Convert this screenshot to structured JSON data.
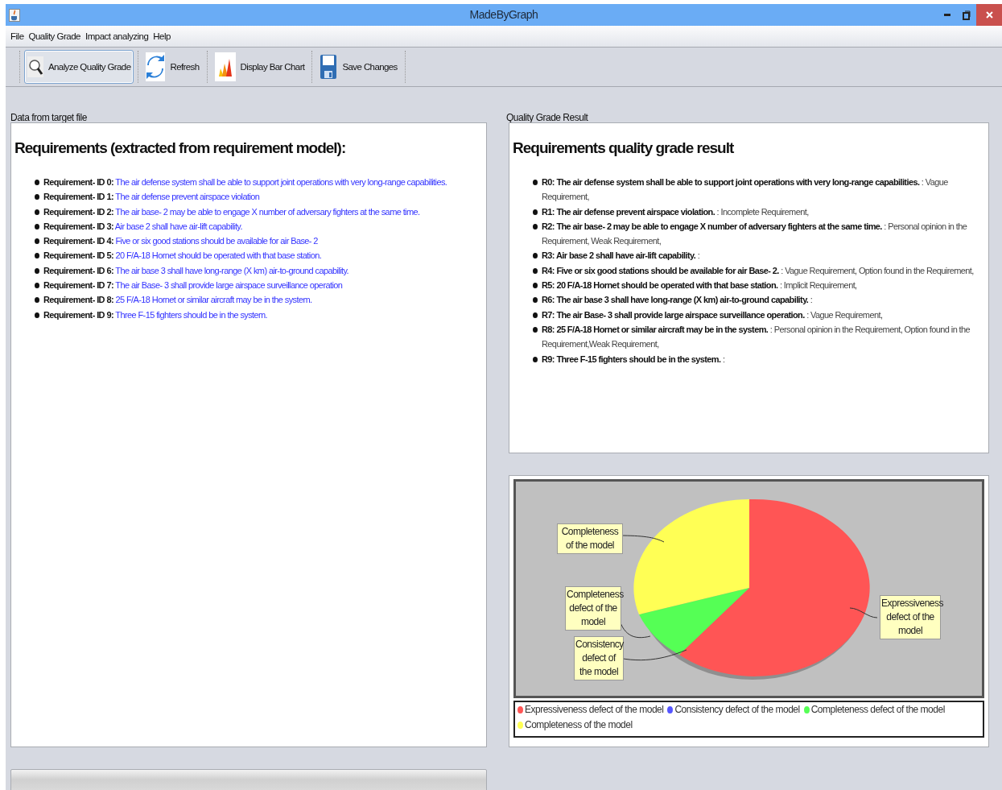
{
  "window": {
    "title": "MadeByGraph"
  },
  "menu": [
    "File",
    "Quality Grade",
    "Impact analyzing",
    "Help"
  ],
  "toolbar": [
    {
      "kind": "analyze",
      "label": "Analyze Quality Grade",
      "pressed": true
    },
    {
      "kind": "refresh",
      "label": "Refresh",
      "pressed": false
    },
    {
      "kind": "chart",
      "label": "Display Bar Chart",
      "pressed": false
    },
    {
      "kind": "save",
      "label": "Save Changes",
      "pressed": false
    }
  ],
  "data_panel": {
    "caption": "Data from target file",
    "heading": "Requirements (extracted from requirement model):",
    "items": [
      {
        "label": "Requirement- ID 0:",
        "text": "The air defense system shall be able to support joint operations with very long-range capabilities."
      },
      {
        "label": "Requirement- ID 1:",
        "text": "The air defense prevent airspace violation"
      },
      {
        "label": "Requirement- ID 2:",
        "text": "The air base- 2 may be able to engage X number of adversary fighters at the same time."
      },
      {
        "label": "Requirement- ID 3:",
        "text": "Air base 2 shall have air-lift capability."
      },
      {
        "label": "Requirement- ID 4:",
        "text": "Five or six good stations should be available for air Base- 2"
      },
      {
        "label": "Requirement- ID 5:",
        "text": "20 F/A-18 Hornet should be operated with that base station."
      },
      {
        "label": "Requirement- ID 6:",
        "text": "The air base 3 shall have long-range (X km) air-to-ground capability."
      },
      {
        "label": "Requirement- ID 7:",
        "text": "The air Base- 3 shall provide large airspace surveillance operation"
      },
      {
        "label": "Requirement- ID 8:",
        "text": "25 F/A-18 Hornet or similar aircraft may be in the system."
      },
      {
        "label": "Requirement- ID 9:",
        "text": "Three F-15 fighters should be in the system."
      }
    ]
  },
  "result_panel": {
    "caption": "Quality Grade Result",
    "heading": "Requirements quality grade result",
    "items": [
      {
        "requirement": "R0: The air defense system shall be able to support joint operations with very long-range capabilities.",
        "grade": ": Vague Requirement,"
      },
      {
        "requirement": "R1: The air defense prevent airspace violation.",
        "grade": ": Incomplete Requirement,"
      },
      {
        "requirement": "R2: The air base- 2 may be able to engage X number of adversary fighters at the same time.",
        "grade": ": Personal opinion in the Requirement, Weak Requirement,"
      },
      {
        "requirement": "R3: Air base 2 shall have air-lift capability.",
        "grade": ":"
      },
      {
        "requirement": "R4: Five or six good stations should be available for air Base- 2.",
        "grade": ": Vague Requirement, Option found in the Requirement,"
      },
      {
        "requirement": "R5: 20 F/A-18 Hornet should be operated with that base station.",
        "grade": ": Implicit Requirement,"
      },
      {
        "requirement": "R6: The air base 3 shall have long-range (X km) air-to-ground capability.",
        "grade": ":"
      },
      {
        "requirement": "R7: The air Base- 3 shall provide large airspace surveillance operation.",
        "grade": ": Vague Requirement,"
      },
      {
        "requirement": "R8: 25 F/A-18 Hornet or similar aircraft may be in the system.",
        "grade": ": Personal opinion in the Requirement, Option found in the Requirement,Weak Requirement,"
      },
      {
        "requirement": "R9: Three F-15 fighters should be in the system.",
        "grade": ":"
      }
    ]
  },
  "chart_panel": {
    "callouts": [
      "Completeness of the model",
      "Completeness defect of the model",
      "Consistency defect of the model",
      "Expressiveness defect of the model"
    ],
    "legend": [
      {
        "label": "Expressiveness defect of the model",
        "color": "#ff5555"
      },
      {
        "label": "Consistency defect of the model",
        "color": "#5555ff"
      },
      {
        "label": "Completeness defect of the model",
        "color": "#55ff55"
      },
      {
        "label": "Completeness of the model",
        "color": "#ffff55"
      }
    ]
  }
}
